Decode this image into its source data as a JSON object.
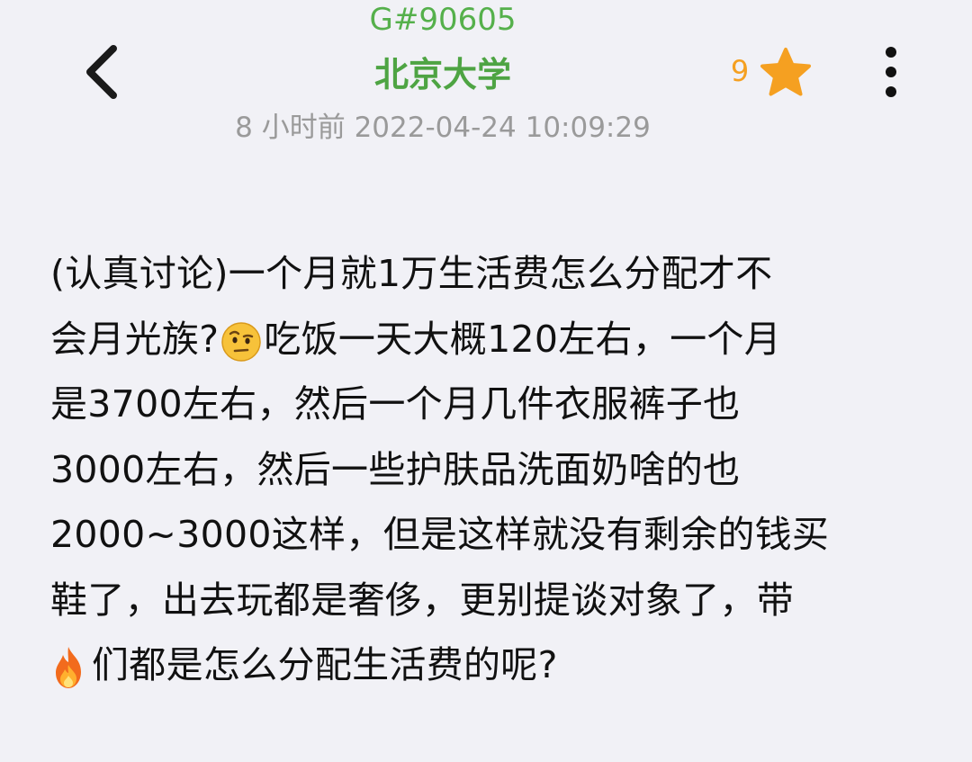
{
  "header": {
    "post_id": "G#90605",
    "board_title": "北京大学",
    "timestamp": "8 小时前 2022-04-24 10:09:29",
    "star_count": "9",
    "icons": {
      "back": "chevron-left-icon",
      "star": "star-icon",
      "more": "more-vertical-icon"
    },
    "colors": {
      "accent_green": "#4ea443",
      "star_orange": "#f5a021",
      "meta_gray": "#9a9a9a"
    }
  },
  "post": {
    "lines": [
      {
        "text": "(认真讨论)一个月就1万生活费怎么分配才不"
      },
      {
        "before": "会月光族?",
        "emoji": "face-with-raised-eyebrow-emoji",
        "after": "吃饭一天大概120左右，一个月"
      },
      {
        "text": "是3700左右，然后一个月几件衣服裤子也"
      },
      {
        "text": "3000左右，然后一些护肤品洗面奶啥的也"
      },
      {
        "text": "2000~3000这样，但是这样就没有剩余的钱买"
      },
      {
        "text": "鞋了，出去玩都是奢侈，更别提谈对象了，带"
      },
      {
        "emoji": "fire-emoji",
        "after": "们都是怎么分配生活费的呢?"
      }
    ]
  }
}
